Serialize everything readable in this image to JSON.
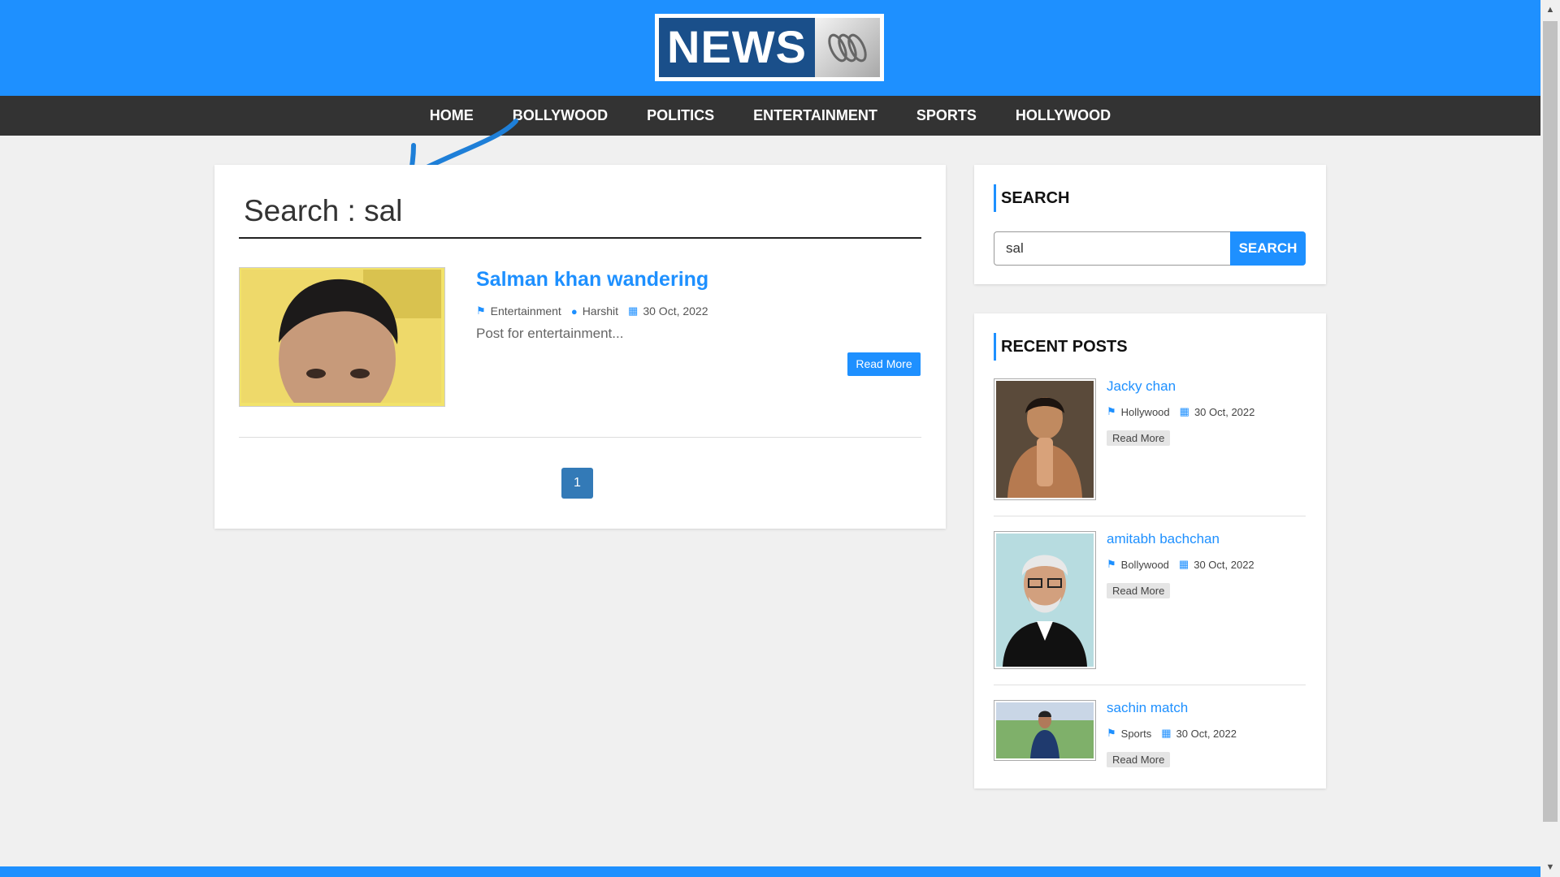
{
  "nav": {
    "items": [
      "HOME",
      "BOLLYWOOD",
      "POLITICS",
      "ENTERTAINMENT",
      "SPORTS",
      "HOLLYWOOD"
    ]
  },
  "logo": {
    "text": "NEWS"
  },
  "main": {
    "search_title": "Search : sal",
    "post": {
      "title": "Salman khan wandering",
      "category": "Entertainment",
      "author": "Harshit",
      "date": "30 Oct, 2022",
      "excerpt": "Post for entertainment...",
      "read_more": "Read More"
    },
    "pagination": {
      "current": "1"
    }
  },
  "sidebar": {
    "search": {
      "title": "SEARCH",
      "value": "sal",
      "button": "SEARCH"
    },
    "recent": {
      "title": "RECENT POSTS",
      "items": [
        {
          "title": "Jacky chan",
          "category": "Hollywood",
          "date": "30 Oct, 2022",
          "read_more": "Read More"
        },
        {
          "title": "amitabh bachchan",
          "category": "Bollywood",
          "date": "30 Oct, 2022",
          "read_more": "Read More"
        },
        {
          "title": "sachin match",
          "category": "Sports",
          "date": "30 Oct, 2022",
          "read_more": "Read More"
        }
      ]
    }
  },
  "colors": {
    "accent": "#1e90ff",
    "nav_bg": "#333333",
    "page_bg": "#f0f0f0",
    "pagination": "#337ab7"
  },
  "icons": [
    "tag-icon",
    "user-icon",
    "calendar-icon",
    "arrow-annotation"
  ]
}
